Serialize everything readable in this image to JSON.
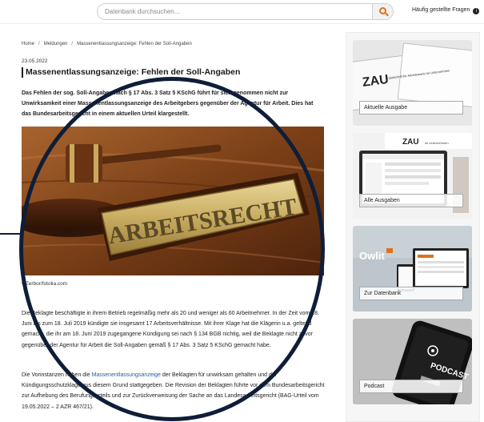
{
  "search": {
    "placeholder": "Datenbank durchsuchen..."
  },
  "header": {
    "faq_label": "Häufig gestellte Fragen"
  },
  "breadcrumb": {
    "home": "Home",
    "meldungen": "Meldungen",
    "current": "Massenentlassungsanzeige: Fehlen der Soll-Angaben"
  },
  "article": {
    "date": "23.05.2022",
    "title": "Massenentlassungsanzeige: Fehlen der Soll-Angaben",
    "lead": "Das Fehlen der sog. Soll-Angaben nach § 17 Abs. 3 Satz 5 KSchG führt für sich genommen nicht zur Unwirksamkeit einer Massenentlassungsanzeige des Arbeitgebers gegenüber der Agentur für Arbeit. Dies hat das Bundesarbeitsgericht in einem aktuellen Urteil klargestellt.",
    "image_sign_text": "ARBEITSRECHT",
    "image_credit": "©Zerbor/fotolia.com",
    "p1": "Die Beklagte beschäftigte in ihrem Betrieb regelmäßig mehr als 20 und weniger als 60 Arbeitnehmer. In der Zeit vom 18. Juni bis zum 18. Juli 2019 kündigte sie insgesamt 17 Arbeitsverhältnisse. Mit ihrer Klage hat die Klägerin u.a. geltend gemacht, die ihr am 18. Juni 2019 zugegangene Kündigung sei nach § 134 BGB nichtig, weil die Beklagte nicht zuvor gegenüber der Agentur für Arbeit die Soll-Angaben gemäß § 17 Abs. 3 Satz 5 KSchG gemacht habe.",
    "p2_before": "Die Vorinstanzen haben die ",
    "p2_link": "Massenentlassungsanzeige",
    "p2_after": " der Beklagten für unwirksam gehalten und der Kündigungsschutzklage aus diesem Grund stattgegeben. Die Revision der Beklagten führte vor dem Bundesarbeitsgericht zur Aufhebung des Berufungsurteils und zur Zurückverweisung der Sache an das Landesarbeitsgericht (BAG-Urteil vom 19.05.2022 – 2 AZR 467/21)."
  },
  "sidebar": {
    "cards": [
      {
        "label": "Aktuelle Ausgabe",
        "cover_title": "ZAU",
        "cover_subtitle": "Zeitschrift für Arbeitsmarkt im Unternehmen"
      },
      {
        "label": "Alle Ausgaben",
        "cover_title": "ZAU",
        "cover_subtitle": "im Unternehmen"
      },
      {
        "label": "Zur Datenbank",
        "logo_text": "Owlit"
      },
      {
        "label": "Podcast",
        "podcast_text": "PODCAST"
      }
    ]
  },
  "colors": {
    "accent": "#e0711c",
    "link": "#1f5fa8",
    "annotation": "#0f1e38"
  }
}
